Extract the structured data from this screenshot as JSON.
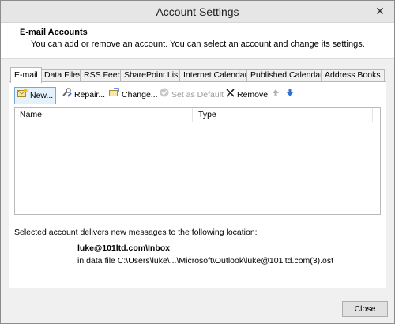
{
  "window": {
    "title": "Account Settings",
    "close_glyph": "✕"
  },
  "header": {
    "title": "E-mail Accounts",
    "subtitle": "You can add or remove an account. You can select an account and change its settings."
  },
  "tabs": [
    {
      "label": "E-mail",
      "active": true
    },
    {
      "label": "Data Files"
    },
    {
      "label": "RSS Feeds"
    },
    {
      "label": "SharePoint Lists"
    },
    {
      "label": "Internet Calendars"
    },
    {
      "label": "Published Calendars"
    },
    {
      "label": "Address Books"
    }
  ],
  "toolbar": {
    "new_label": "New...",
    "repair_label": "Repair...",
    "change_label": "Change...",
    "set_default_label": "Set as Default",
    "remove_label": "Remove"
  },
  "list": {
    "col_name": "Name",
    "col_type": "Type"
  },
  "delivery": {
    "text": "Selected account delivers new messages to the following location:",
    "location": "luke@101ltd.com\\Inbox",
    "file": "in data file C:\\Users\\luke\\...\\Microsoft\\Outlook\\luke@101ltd.com(3).ost"
  },
  "footer": {
    "close_label": "Close"
  },
  "colors": {
    "accent": "#2f6fd6",
    "panel_bg": "#ffffff",
    "chrome_bg": "#f0f0f0"
  }
}
